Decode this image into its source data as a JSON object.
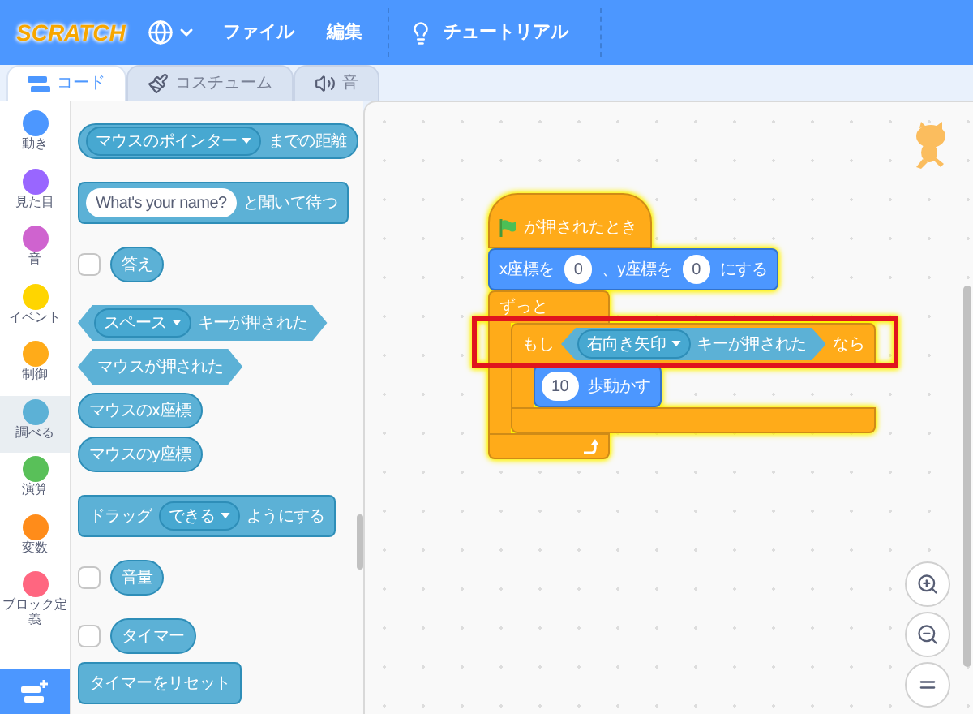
{
  "menu_bar": {
    "logo": "SCRATCH",
    "items": [
      "ファイル",
      "編集"
    ],
    "tutorial": "チュートリアル"
  },
  "tabs": [
    {
      "label": "コード",
      "selected": true,
      "kind": "code"
    },
    {
      "label": "コスチューム",
      "selected": false,
      "kind": "costume"
    },
    {
      "label": "音",
      "selected": false,
      "kind": "sound"
    }
  ],
  "categories": [
    {
      "label": "動き",
      "color": "#4c97ff",
      "selected": false
    },
    {
      "label": "見た目",
      "color": "#9966ff",
      "selected": false
    },
    {
      "label": "音",
      "color": "#cf63cf",
      "selected": false
    },
    {
      "label": "イベント",
      "color": "#ffd500",
      "selected": false
    },
    {
      "label": "制御",
      "color": "#ffab19",
      "selected": false
    },
    {
      "label": "調べる",
      "color": "#5cb1d6",
      "selected": true
    },
    {
      "label": "演算",
      "color": "#59c059",
      "selected": false
    },
    {
      "label": "変数",
      "color": "#ff8c1a",
      "selected": false
    },
    {
      "label": "ブロック定義",
      "color": "#ff6680",
      "selected": false
    }
  ],
  "palette": [
    [
      {
        "kind": "reporter",
        "parts": [
          {
            "kind": "dropdown",
            "text": "マウスのポインター"
          },
          {
            "kind": "text",
            "text": "までの距離"
          }
        ]
      }
    ],
    [
      {
        "kind": "stack",
        "parts": [
          {
            "kind": "input",
            "text": "What's your name?"
          },
          {
            "kind": "text",
            "text": "と聞いて待つ"
          }
        ]
      }
    ],
    [
      {
        "kind": "reporter",
        "checked": false,
        "parts": [
          {
            "kind": "text",
            "text": "答え"
          }
        ]
      }
    ],
    [
      {
        "kind": "boolean",
        "parts": [
          {
            "kind": "dropdown",
            "text": "スペース"
          },
          {
            "kind": "text",
            "text": "キーが押された"
          }
        ]
      },
      {
        "kind": "boolean",
        "parts": [
          {
            "kind": "text",
            "text": "マウスが押された"
          }
        ]
      },
      {
        "kind": "reporter",
        "parts": [
          {
            "kind": "text",
            "text": "マウスのx座標"
          }
        ]
      },
      {
        "kind": "reporter",
        "parts": [
          {
            "kind": "text",
            "text": "マウスのy座標"
          }
        ]
      }
    ],
    [
      {
        "kind": "stack",
        "parts": [
          {
            "kind": "text",
            "text": "ドラッグ"
          },
          {
            "kind": "dropdown",
            "text": "できる"
          },
          {
            "kind": "text",
            "text": "ようにする"
          }
        ]
      }
    ],
    [
      {
        "kind": "reporter",
        "checked": false,
        "parts": [
          {
            "kind": "text",
            "text": "音量"
          }
        ]
      }
    ],
    [
      {
        "kind": "reporter",
        "checked": false,
        "parts": [
          {
            "kind": "text",
            "text": "タイマー"
          }
        ]
      },
      {
        "kind": "stack",
        "parts": [
          {
            "kind": "text",
            "text": "タイマーをリセット"
          }
        ]
      }
    ]
  ],
  "script": {
    "hat": "が押されたとき",
    "blocks": [
      {
        "kind": "motion",
        "parts": [
          {
            "kind": "text",
            "text": "x座標を"
          },
          {
            "kind": "input",
            "text": "0"
          },
          {
            "kind": "text",
            "text": "、y座標を"
          },
          {
            "kind": "input",
            "text": "0"
          },
          {
            "kind": "text",
            "text": "にする"
          }
        ]
      },
      {
        "kind": "forever",
        "label": "ずっと",
        "children": [
          {
            "kind": "if",
            "label": "もし",
            "then_label": "なら",
            "highlighted": true,
            "condition": [
              {
                "kind": "dropdown",
                "text": "右向き矢印"
              },
              {
                "kind": "text",
                "text": "キーが押された"
              }
            ],
            "children": [
              {
                "kind": "motion",
                "parts": [
                  {
                    "kind": "input",
                    "text": "10"
                  },
                  {
                    "kind": "text",
                    "text": "歩動かす"
                  }
                ]
              }
            ]
          }
        ]
      }
    ]
  }
}
